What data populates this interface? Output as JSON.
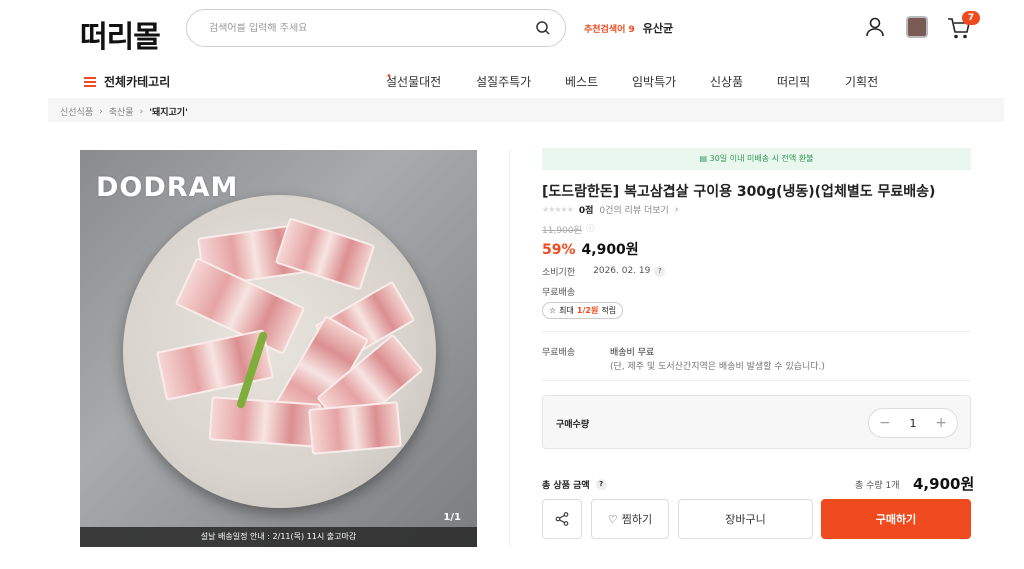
{
  "header": {
    "logo": "떠리몰",
    "search_placeholder": "검색어를 입력해 주세요",
    "trend_label": "추천검색어 9",
    "trend_value": "유산균",
    "cart_count": "7"
  },
  "nav": {
    "all_categories": "전체카테고리",
    "items": [
      "설선물대전",
      "설질주특가",
      "베스트",
      "임박특가",
      "신상품",
      "떠리픽",
      "기획전"
    ],
    "new_dot": "•"
  },
  "breadcrumb": [
    "신선식품",
    "축산물",
    "'돼지고기'"
  ],
  "image": {
    "brand": "DODRAM",
    "pager": "1/1",
    "notice": "설날 배송일정 안내 : 2/11(목) 11시 출고마감"
  },
  "product": {
    "refund_banner": "30일 이내 미배송 시 전액 환불",
    "title": "[도드람한돈] 복고삼겹살 구이용 300g(냉동)(업체별도 무료배송)",
    "score": "0점",
    "reviews": "0건의 리뷰 더보기",
    "original_price": "11,900원",
    "discount": "59%",
    "price": "4,900원",
    "expiry_label": "소비기한",
    "expiry_value": "2026. 02. 19",
    "free_shipping": "무료배송",
    "reward_prefix": "최대",
    "reward_highlight": "1/2원",
    "reward_suffix": "적립",
    "ship_label": "무료배송",
    "ship_fee": "배송비 무료",
    "ship_note": "(단, 제주 및 도서산간지역은 배송비 발생할 수 있습니다.)",
    "qty_label": "구매수량",
    "qty_value": "1",
    "total_label": "총 상품 금액",
    "total_qty": "총 수량 1개",
    "total_amount": "4,900원"
  },
  "buttons": {
    "wish": "찜하기",
    "cart": "장바구니",
    "buy": "구매하기"
  },
  "colors": {
    "accent": "#f04a1f",
    "refund_bg": "#eaf7ee",
    "refund_text": "#2f9a55"
  }
}
